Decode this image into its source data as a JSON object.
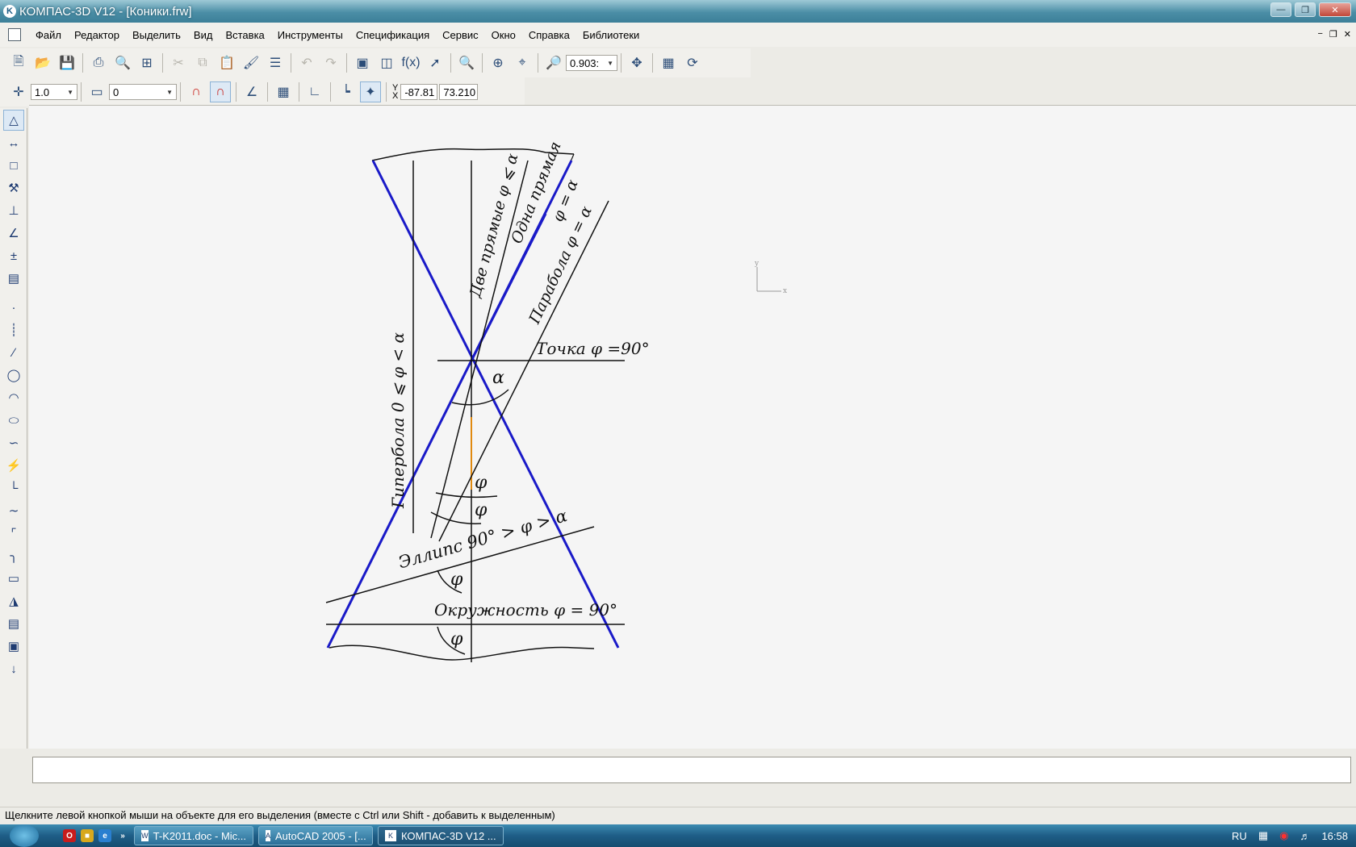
{
  "window": {
    "title": "КОМПАС-3D V12 - [Коники.frw]",
    "app_icon": "kompas-logo-icon"
  },
  "menu": {
    "items": [
      {
        "label": "Файл"
      },
      {
        "label": "Редактор"
      },
      {
        "label": "Выделить"
      },
      {
        "label": "Вид"
      },
      {
        "label": "Вставка"
      },
      {
        "label": "Инструменты"
      },
      {
        "label": "Спецификация"
      },
      {
        "label": "Сервис"
      },
      {
        "label": "Окно"
      },
      {
        "label": "Справка"
      },
      {
        "label": "Библиотеки"
      }
    ]
  },
  "toolbar": {
    "zoom_value": "0.903:",
    "fx_label": "f(x)"
  },
  "toolbar2": {
    "step_value": "1.0",
    "layer_value": "0",
    "coord_y_label": "Y",
    "coord_x_label": "X",
    "coord_x_value": "-87.81",
    "coord_y_value": "73.210"
  },
  "drawing": {
    "labels": {
      "hyperbola": "Гипербола  0 ⩽ φ < α",
      "two_lines": "Две прямые  φ ⩽ α",
      "one_line": "Одна прямая",
      "one_line_cond": "φ = α",
      "parabola": "Парабола  φ = α",
      "point": "Точка φ =90°",
      "alpha": "α",
      "phi1": "φ",
      "phi2": "φ",
      "ellipse": "Эллипс 90°  >  φ > α",
      "phi3": "φ",
      "circle": "Окружность φ  =  90°",
      "phi4": "φ"
    },
    "axes_x": "x",
    "axes_y": "y",
    "colors": {
      "cone": "#1a1ac8",
      "axis_highlight": "#e08a10",
      "lines": "#111111"
    }
  },
  "status": {
    "hint": "Щелкните левой кнопкой мыши на объекте для его выделения (вместе с Ctrl или Shift - добавить к выделенным)"
  },
  "taskbar": {
    "tasks": [
      {
        "label": "T-K2011.doc - Mic..."
      },
      {
        "label": "AutoCAD 2005 - [..."
      },
      {
        "label": "КОМПАС-3D V12 ..."
      }
    ],
    "lang": "RU",
    "time": "16:58"
  }
}
